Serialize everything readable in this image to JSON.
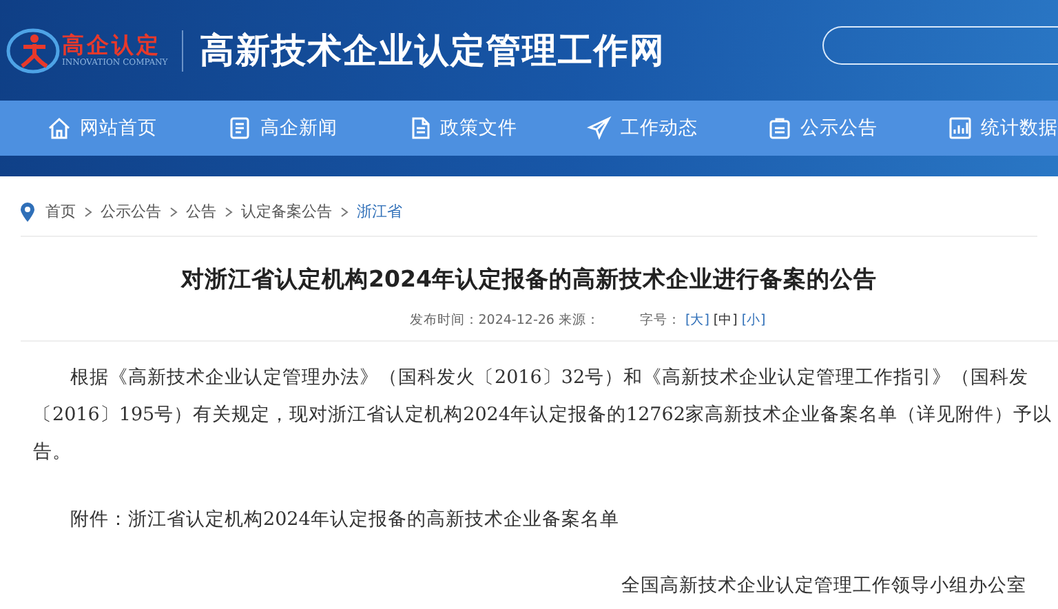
{
  "header": {
    "logo_text": "高企认定",
    "logo_subtext": "INNOVATION COMPANY",
    "site_title": "高新技术企业认定管理工作网"
  },
  "nav": [
    {
      "label": "网站首页",
      "kind": "home"
    },
    {
      "label": "高企新闻",
      "kind": "news"
    },
    {
      "label": "政策文件",
      "kind": "policy"
    },
    {
      "label": "工作动态",
      "kind": "updates"
    },
    {
      "label": "公示公告",
      "kind": "notices"
    },
    {
      "label": "统计数据",
      "kind": "stats"
    }
  ],
  "breadcrumb": [
    {
      "label": "首页",
      "current": false
    },
    {
      "label": "公示公告",
      "current": false
    },
    {
      "label": "公告",
      "current": false
    },
    {
      "label": "认定备案公告",
      "current": false
    },
    {
      "label": "浙江省",
      "current": true
    }
  ],
  "article": {
    "title": "对浙江省认定机构2024年认定报备的高新技术企业进行备案的公告",
    "meta": "发布时间：2024-12-26 来源：",
    "font_size_label": "字号：",
    "font_sizes": [
      {
        "label": "[大]",
        "selected": false
      },
      {
        "label": "[中]",
        "selected": true
      },
      {
        "label": "[小]",
        "selected": false
      }
    ],
    "paragraph_lines": [
      "根据《高新技术企业认定管理办法》（国科发火〔2016〕32号）和《高新技术企业认定管理工作指引》（国科发",
      "〔2016〕195号）有关规定，现对浙江省认定机构2024年认定报备的12762家高新技术企业备案名单（详见附件）予以",
      "告。"
    ],
    "attachment": "附件：浙江省认定机构2024年认定报备的高新技术企业备案名单",
    "signature": "全国高新技术企业认定管理工作领导小组办公室"
  }
}
